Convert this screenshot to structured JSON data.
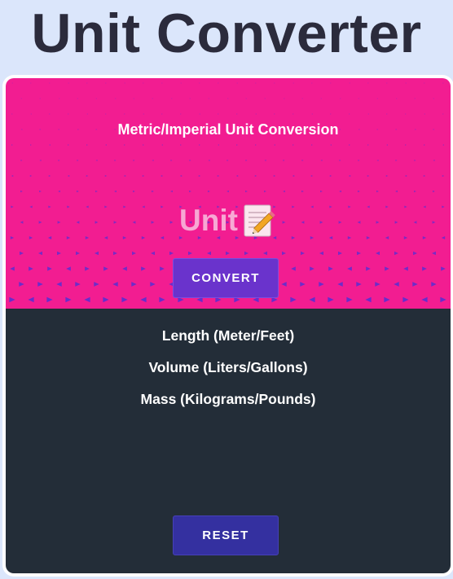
{
  "header": {
    "title": "Unit Converter"
  },
  "hero": {
    "subtitle": "Metric/Imperial Unit Conversion",
    "heading_text": "Unit",
    "heading_icon": "memo-icon",
    "convert_label": "CONVERT"
  },
  "results": {
    "lines": [
      "Length (Meter/Feet)",
      "Volume (Liters/Gallons)",
      "Mass (Kilograms/Pounds)"
    ],
    "reset_label": "RESET"
  },
  "colors": {
    "page_background": "#dbe6fb",
    "title": "#2b2b3c",
    "hero_background": "#f21d91",
    "hero_pattern": "#5b2fd0",
    "unit_heading": "#f7a8d4",
    "results_background": "#232d38",
    "convert_button": "#6a33cc",
    "reset_button": "#3430a0"
  }
}
